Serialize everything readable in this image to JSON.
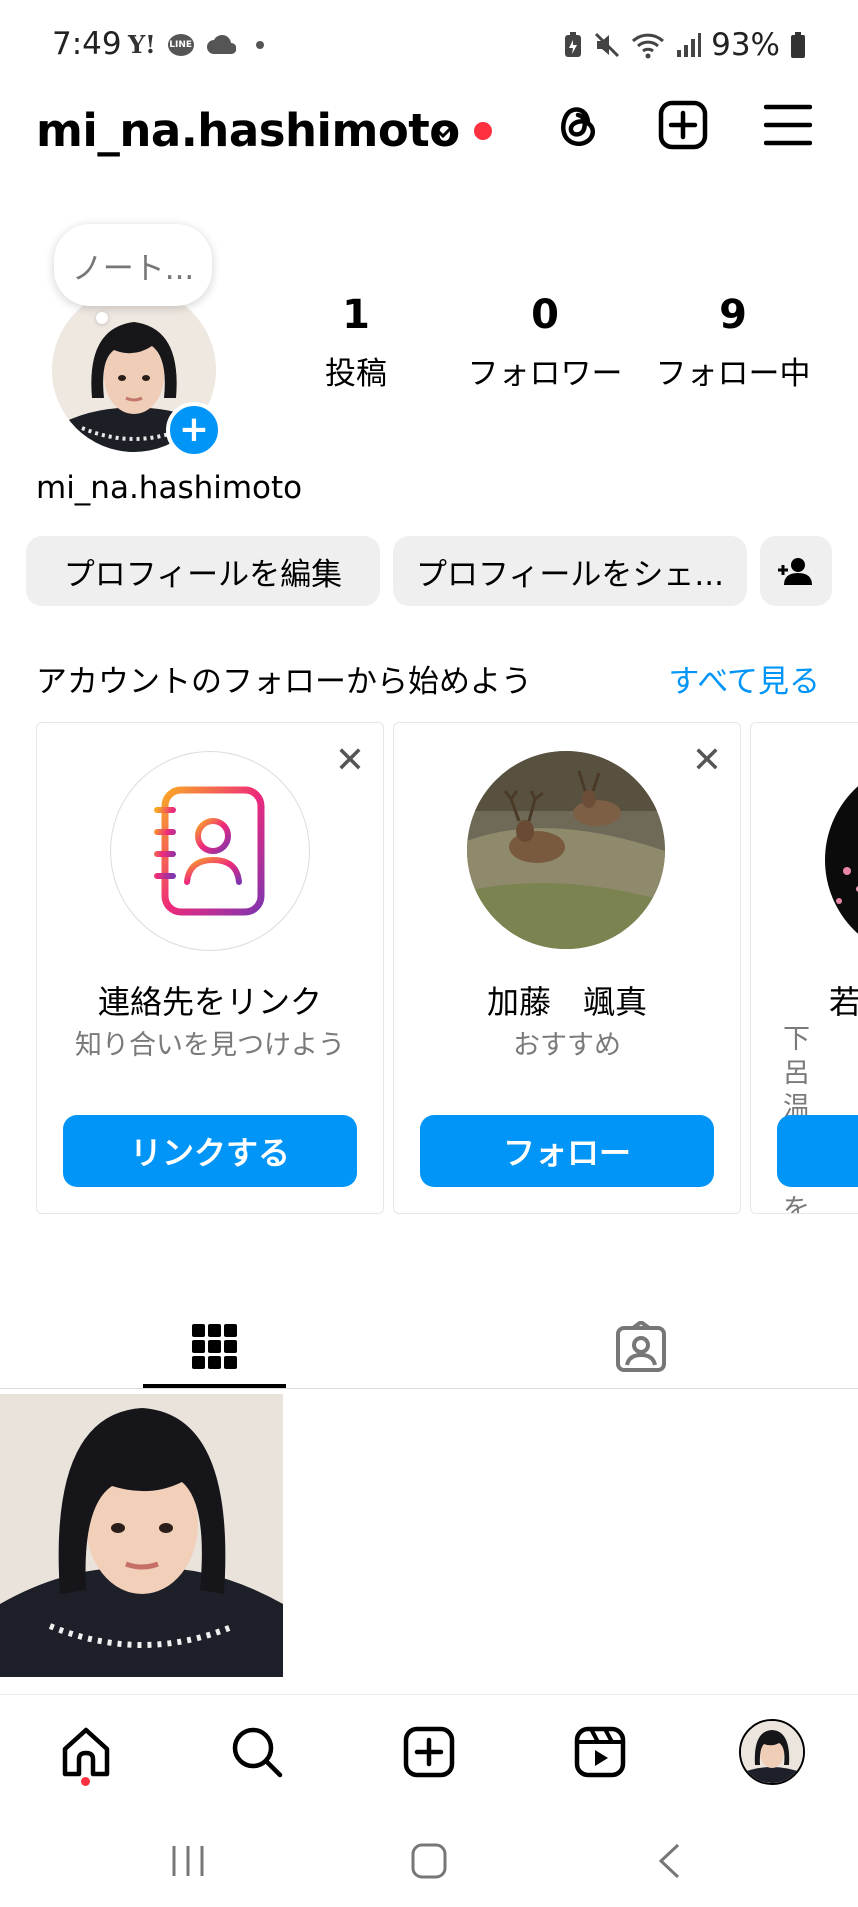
{
  "status_bar": {
    "time": "7:49",
    "left_icons": [
      "yahoo-icon",
      "line-icon",
      "cloud-icon",
      "dot-icon"
    ],
    "battery": "93%",
    "right_icons": [
      "battery-saver-icon",
      "mute-icon",
      "wifi-icon",
      "signal-icon",
      "battery-icon"
    ]
  },
  "header": {
    "username": "mi_na.hashimoto",
    "dropdown_icon": "chevron-down-icon",
    "notification_dot_color": "#ff3040",
    "icons": [
      "threads-icon",
      "create-icon",
      "menu-icon"
    ]
  },
  "profile": {
    "note_placeholder": "ノート...",
    "stats": [
      {
        "value": "1",
        "label": "投稿"
      },
      {
        "value": "0",
        "label": "フォロワー"
      },
      {
        "value": "9",
        "label": "フォロー中"
      }
    ],
    "name": "mi_na.hashimoto",
    "edit_button": "プロフィールを編集",
    "share_button": "プロフィールをシェ...",
    "add_person_icon": "add-person-icon"
  },
  "suggestions": {
    "title": "アカウントのフォローから始めよう",
    "see_all": "すべて見る",
    "cards": [
      {
        "name": "連絡先をリンク",
        "subtitle": "知り合いを見つけよう",
        "button": "リンクする"
      },
      {
        "name": "加藤　颯真",
        "subtitle": "おすすめ",
        "button": "フォロー"
      },
      {
        "name": "若",
        "subtitle": "下呂温 性化を",
        "button": ""
      }
    ]
  },
  "tabs": {
    "items": [
      "grid-icon",
      "tagged-icon"
    ],
    "active": 0
  },
  "bottom_nav": {
    "items": [
      "home-icon",
      "search-icon",
      "create-icon",
      "reels-icon",
      "profile-avatar"
    ]
  },
  "colors": {
    "accent": "#0095f6",
    "button_gray": "#efefef",
    "notification": "#ff3040"
  }
}
